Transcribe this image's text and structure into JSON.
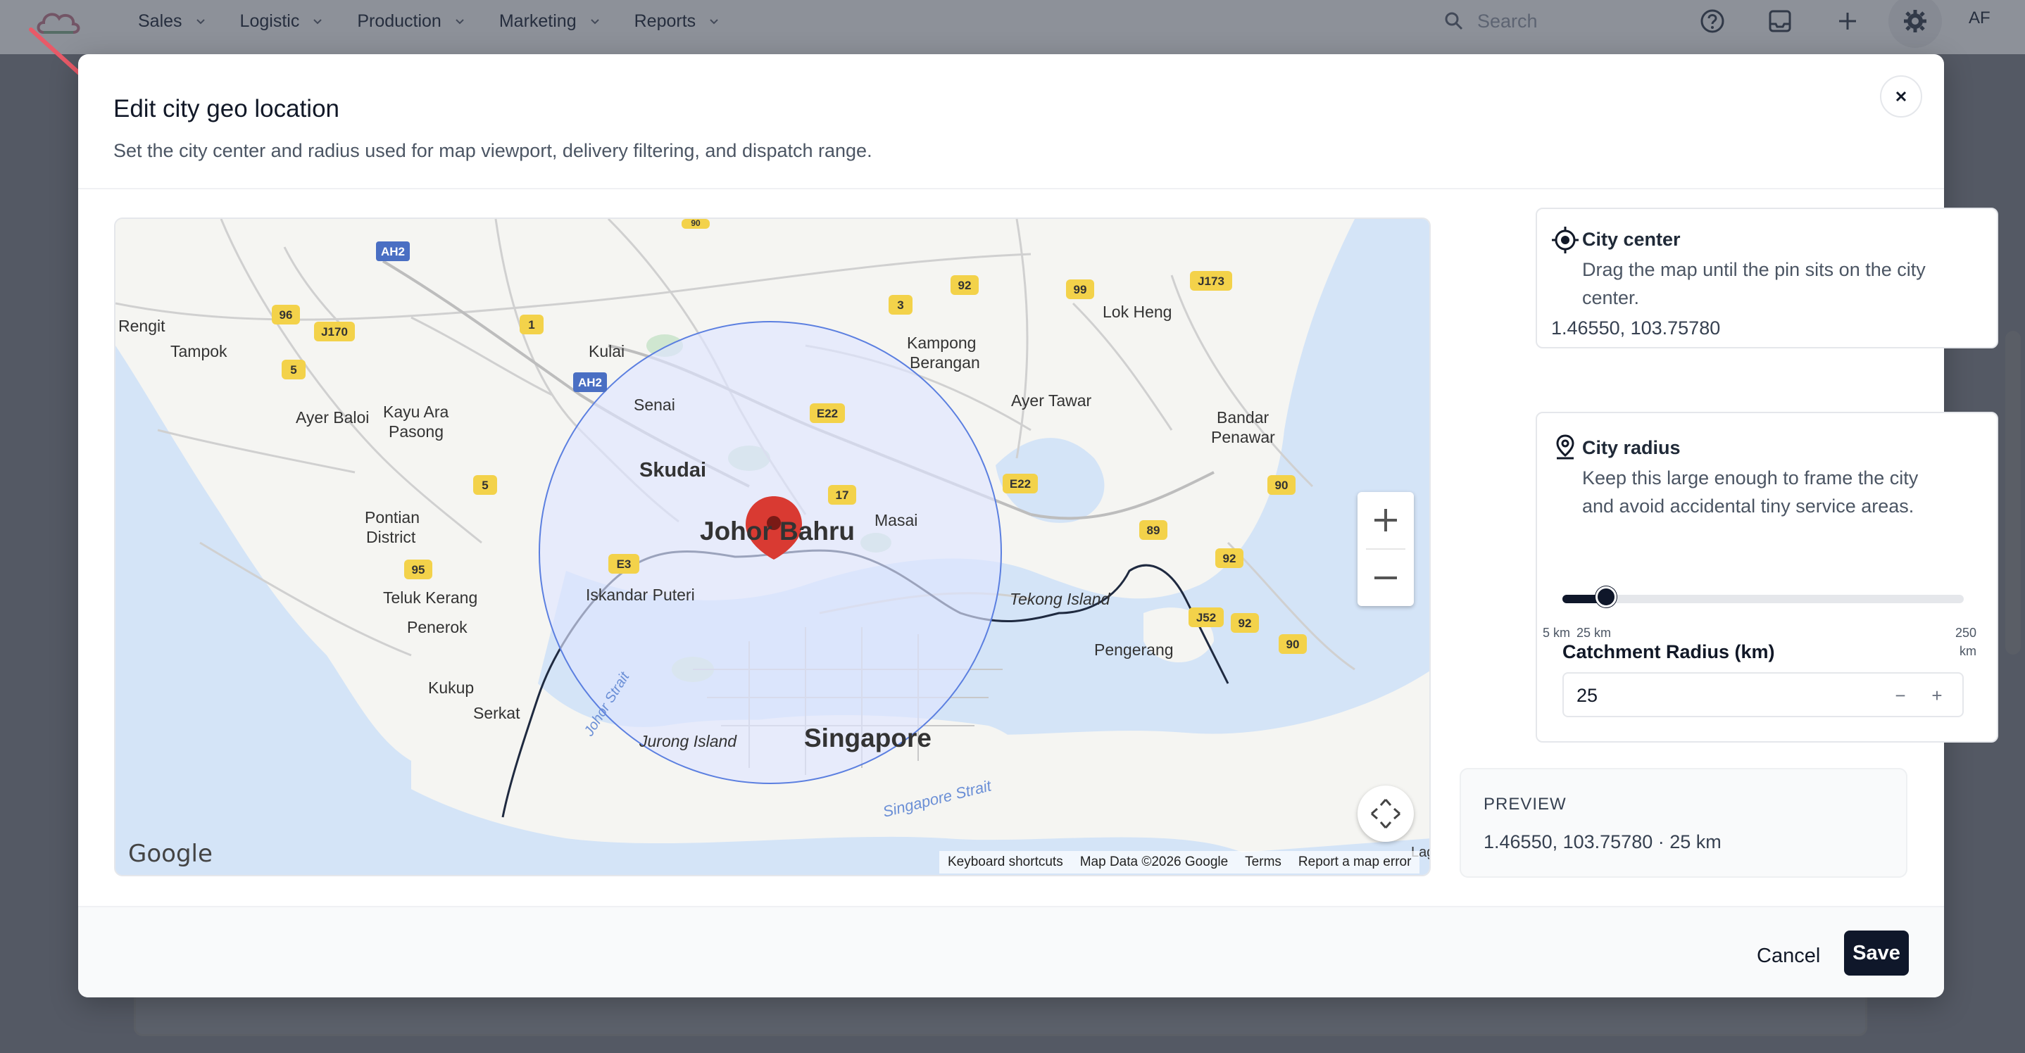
{
  "nav": {
    "items": [
      {
        "label": "Sales"
      },
      {
        "label": "Logistic"
      },
      {
        "label": "Production"
      },
      {
        "label": "Marketing"
      },
      {
        "label": "Reports"
      }
    ],
    "search_placeholder": "Search",
    "avatar_initials": "AF"
  },
  "modal": {
    "title": "Edit city geo location",
    "subtitle": "Set the city center and radius used for map viewport, delivery filtering, and dispatch range."
  },
  "map": {
    "labels": {
      "rengit": "Rengit",
      "tampok": "Tampok",
      "kulai": "Kulai",
      "senai": "Senai",
      "skudai": "Skudai",
      "johor_bahru": "Johor Bahru",
      "masai": "Masai",
      "ayer_baloi": "Ayer Baloi",
      "kayu_ara_pasong_1": "Kayu Ara",
      "kayu_ara_pasong_2": "Pasong",
      "pontian_1": "Pontian",
      "pontian_2": "District",
      "teluk_kerang": "Teluk Kerang",
      "penerok": "Penerok",
      "kukup": "Kukup",
      "serkat": "Serkat",
      "iskandar_puteri": "Iskandar Puteri",
      "singapore": "Singapore",
      "jurong_island": "Jurong Island",
      "johor_strait": "Johor Strait",
      "singapore_strait": "Singapore Strait",
      "kampong_1": "Kampong",
      "kampong_2": "Berangan",
      "ayer_tawar": "Ayer Tawar",
      "lok_heng": "Lok Heng",
      "bandar_1": "Bandar",
      "bandar_2": "Penawar",
      "tekong": "Tekong Island",
      "pengerang": "Pengerang",
      "lagoon": "Lagc"
    },
    "shields": {
      "ah2_a": "AH2",
      "ah2_b": "AH2",
      "r96": "96",
      "j170": "J170",
      "r5a": "5",
      "r1": "1",
      "r3": "3",
      "r92a": "92",
      "r99": "99",
      "j173": "J173",
      "e22a": "E22",
      "e22b": "E22",
      "r17": "17",
      "r5b": "5",
      "r95": "95",
      "e3": "E3",
      "r90a": "90",
      "r89": "89",
      "r92b": "92",
      "j52": "J52",
      "r92c": "92",
      "r90b": "90",
      "r90c": "90"
    },
    "google": "Google",
    "footer": {
      "shortcuts": "Keyboard shortcuts",
      "data": "Map Data ©2026 Google",
      "terms": "Terms",
      "report": "Report a map error"
    }
  },
  "city_center": {
    "title": "City center",
    "desc": "Drag the map until the pin sits on the city center.",
    "coords": "1.46550, 103.75780"
  },
  "city_radius": {
    "title": "City radius",
    "desc": "Keep this large enough to frame the city and avoid accidental tiny service areas.",
    "slider_min": 5,
    "slider_max": 250,
    "slider_value": 25,
    "tick_min": "5 km",
    "tick_value": "25 km",
    "tick_max_1": "250",
    "tick_max_2": "km",
    "field_label": "Catchment Radius (km)",
    "field_value": "25",
    "minus": "−",
    "plus": "+"
  },
  "preview": {
    "label": "PREVIEW",
    "value": "1.46550, 103.75780 · 25 km"
  },
  "footer": {
    "cancel": "Cancel",
    "save": "Save"
  },
  "colors": {
    "highlight": "#e85a68",
    "primary": "#0f172a",
    "radius_fill": "#dfe5ff",
    "radius_stroke": "#5b7fe0",
    "pin": "#d93a32"
  }
}
